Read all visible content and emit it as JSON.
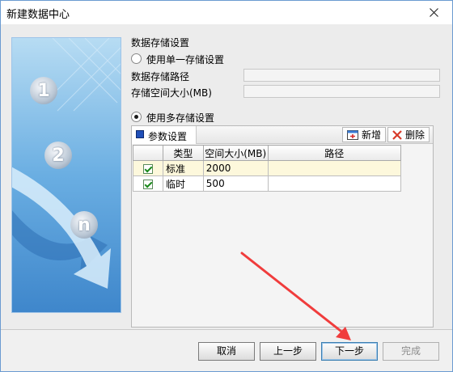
{
  "window": {
    "title": "新建数据中心"
  },
  "storage": {
    "section_title": "数据存储设置",
    "single_option": "使用单一存储设置",
    "path_label": "数据存储路径",
    "size_label": "存储空间大小(MB)",
    "multi_option": "使用多存储设置"
  },
  "params": {
    "tab_label": "参数设置",
    "add_label": "新增",
    "delete_label": "删除",
    "columns": [
      "类型",
      "空间大小(MB)",
      "路径"
    ],
    "rows": [
      {
        "type": "标准",
        "size": "2000",
        "path": ""
      },
      {
        "type": "临时",
        "size": "500",
        "path": ""
      }
    ]
  },
  "buttons": {
    "cancel": "取消",
    "prev": "上一步",
    "next": "下一步",
    "finish": "完成"
  },
  "banner": {
    "steps": [
      "1",
      "2",
      "n"
    ]
  },
  "colors": {
    "accent": "#3c7fb1",
    "arrow": "#f03c3c",
    "banner": "#4a8fd0"
  }
}
